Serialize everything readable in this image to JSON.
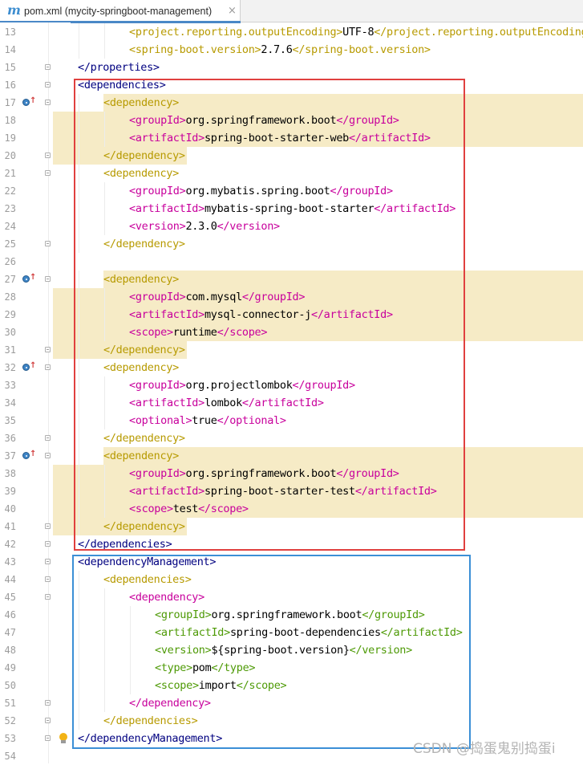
{
  "tab": {
    "icon_letter": "m",
    "title": "pom.xml (mycity-springboot-management)",
    "close_glyph": "×"
  },
  "watermark": "CSDN @捣蛋鬼别捣蛋i",
  "colors": {
    "tag": "#000080",
    "inner_tag": "#c8009c",
    "highlight": "#f6ebc6",
    "red_box": "#e0403f",
    "blue_box": "#3b8fd6"
  },
  "lines": [
    {
      "n": "13",
      "parts": [
        [
          "tag",
          "<project.reporting.outputEncoding>"
        ],
        [
          "txt",
          "UTF-8"
        ],
        [
          "tag",
          "</project.reporting.outputEncoding>"
        ]
      ],
      "indent": 2,
      "style": "hd"
    },
    {
      "n": "14",
      "parts": [
        [
          "tag",
          "<spring-boot.version>"
        ],
        [
          "txt",
          "2.7.6"
        ],
        [
          "tag",
          "</spring-boot.version>"
        ]
      ],
      "indent": 2,
      "style": "hd"
    },
    {
      "n": "15",
      "parts": [
        [
          "tag",
          "</properties>"
        ]
      ],
      "indent": 0,
      "style": "plain",
      "fold": true
    },
    {
      "n": "16",
      "parts": [
        [
          "tag",
          "<dependencies>"
        ]
      ],
      "indent": 0,
      "style": "plain",
      "fold": true
    },
    {
      "n": "17",
      "parts": [
        [
          "tag",
          "<dependency>"
        ]
      ],
      "indent": 1,
      "style": "hd",
      "fold": true,
      "icon": true,
      "hl": "open"
    },
    {
      "n": "18",
      "parts": [
        [
          "tag",
          "<groupId>"
        ],
        [
          "txt",
          "org.springframework.boot"
        ],
        [
          "tag",
          "</groupId>"
        ]
      ],
      "indent": 2,
      "style": "inner",
      "hl": "full"
    },
    {
      "n": "19",
      "parts": [
        [
          "tag",
          "<artifactId>"
        ],
        [
          "txt",
          "spring-boot-starter-web"
        ],
        [
          "tag",
          "</artifactId>"
        ]
      ],
      "indent": 2,
      "style": "inner",
      "hl": "full"
    },
    {
      "n": "20",
      "parts": [
        [
          "tag",
          "</dependency>"
        ]
      ],
      "indent": 1,
      "style": "hd",
      "fold": true,
      "hl": "close"
    },
    {
      "n": "21",
      "parts": [
        [
          "tag",
          "<dependency>"
        ]
      ],
      "indent": 1,
      "style": "hd",
      "fold": true
    },
    {
      "n": "22",
      "parts": [
        [
          "tag",
          "<groupId>"
        ],
        [
          "txt",
          "org.mybatis.spring.boot"
        ],
        [
          "tag",
          "</groupId>"
        ]
      ],
      "indent": 2,
      "style": "inner"
    },
    {
      "n": "23",
      "parts": [
        [
          "tag",
          "<artifactId>"
        ],
        [
          "txt",
          "mybatis-spring-boot-starter"
        ],
        [
          "tag",
          "</artifactId>"
        ]
      ],
      "indent": 2,
      "style": "inner"
    },
    {
      "n": "24",
      "parts": [
        [
          "tag",
          "<version>"
        ],
        [
          "txt",
          "2.3.0"
        ],
        [
          "tag",
          "</version>"
        ]
      ],
      "indent": 2,
      "style": "inner"
    },
    {
      "n": "25",
      "parts": [
        [
          "tag",
          "</dependency>"
        ]
      ],
      "indent": 1,
      "style": "hd",
      "fold": true
    },
    {
      "n": "26",
      "parts": [],
      "indent": 0,
      "style": "plain"
    },
    {
      "n": "27",
      "parts": [
        [
          "tag",
          "<dependency>"
        ]
      ],
      "indent": 1,
      "style": "hd",
      "fold": true,
      "icon": true,
      "hl": "open"
    },
    {
      "n": "28",
      "parts": [
        [
          "tag",
          "<groupId>"
        ],
        [
          "txt",
          "com.mysql"
        ],
        [
          "tag",
          "</groupId>"
        ]
      ],
      "indent": 2,
      "style": "inner",
      "hl": "full"
    },
    {
      "n": "29",
      "parts": [
        [
          "tag",
          "<artifactId>"
        ],
        [
          "txt",
          "mysql-connector-j"
        ],
        [
          "tag",
          "</artifactId>"
        ]
      ],
      "indent": 2,
      "style": "inner",
      "hl": "full"
    },
    {
      "n": "30",
      "parts": [
        [
          "tag",
          "<scope>"
        ],
        [
          "txt",
          "runtime"
        ],
        [
          "tag",
          "</scope>"
        ]
      ],
      "indent": 2,
      "style": "inner",
      "hl": "full"
    },
    {
      "n": "31",
      "parts": [
        [
          "tag",
          "</dependency>"
        ]
      ],
      "indent": 1,
      "style": "hd",
      "fold": true,
      "hl": "close"
    },
    {
      "n": "32",
      "parts": [
        [
          "tag",
          "<dependency>"
        ]
      ],
      "indent": 1,
      "style": "hd",
      "fold": true,
      "icon": true
    },
    {
      "n": "33",
      "parts": [
        [
          "tag",
          "<groupId>"
        ],
        [
          "txt",
          "org.projectlombok"
        ],
        [
          "tag",
          "</groupId>"
        ]
      ],
      "indent": 2,
      "style": "inner"
    },
    {
      "n": "34",
      "parts": [
        [
          "tag",
          "<artifactId>"
        ],
        [
          "txt",
          "lombok"
        ],
        [
          "tag",
          "</artifactId>"
        ]
      ],
      "indent": 2,
      "style": "inner"
    },
    {
      "n": "35",
      "parts": [
        [
          "tag",
          "<optional>"
        ],
        [
          "txt",
          "true"
        ],
        [
          "tag",
          "</optional>"
        ]
      ],
      "indent": 2,
      "style": "inner"
    },
    {
      "n": "36",
      "parts": [
        [
          "tag",
          "</dependency>"
        ]
      ],
      "indent": 1,
      "style": "hd",
      "fold": true
    },
    {
      "n": "37",
      "parts": [
        [
          "tag",
          "<dependency>"
        ]
      ],
      "indent": 1,
      "style": "hd",
      "fold": true,
      "icon": true,
      "hl": "open"
    },
    {
      "n": "38",
      "parts": [
        [
          "tag",
          "<groupId>"
        ],
        [
          "txt",
          "org.springframework.boot"
        ],
        [
          "tag",
          "</groupId>"
        ]
      ],
      "indent": 2,
      "style": "inner",
      "hl": "full"
    },
    {
      "n": "39",
      "parts": [
        [
          "tag",
          "<artifactId>"
        ],
        [
          "txt",
          "spring-boot-starter-test"
        ],
        [
          "tag",
          "</artifactId>"
        ]
      ],
      "indent": 2,
      "style": "inner",
      "hl": "full"
    },
    {
      "n": "40",
      "parts": [
        [
          "tag",
          "<scope>"
        ],
        [
          "txt",
          "test"
        ],
        [
          "tag",
          "</scope>"
        ]
      ],
      "indent": 2,
      "style": "inner",
      "hl": "full"
    },
    {
      "n": "41",
      "parts": [
        [
          "tag",
          "</dependency>"
        ]
      ],
      "indent": 1,
      "style": "hd",
      "fold": true,
      "hl": "close"
    },
    {
      "n": "42",
      "parts": [
        [
          "tag",
          "</dependencies>"
        ]
      ],
      "indent": 0,
      "style": "plain",
      "fold": true
    },
    {
      "n": "43",
      "parts": [
        [
          "tag",
          "<dependencyManagement>"
        ]
      ],
      "indent": 0,
      "style": "plain",
      "fold": true
    },
    {
      "n": "44",
      "parts": [
        [
          "tag",
          "<dependencies>"
        ]
      ],
      "indent": 1,
      "style": "hd",
      "fold": true
    },
    {
      "n": "45",
      "parts": [
        [
          "tag",
          "<dependency>"
        ]
      ],
      "indent": 2,
      "style": "inner",
      "fold": true
    },
    {
      "n": "46",
      "parts": [
        [
          "tag",
          "<groupId>"
        ],
        [
          "txt",
          "org.springframework.boot"
        ],
        [
          "tag",
          "</groupId>"
        ]
      ],
      "indent": 3,
      "style": "green"
    },
    {
      "n": "47",
      "parts": [
        [
          "tag",
          "<artifactId>"
        ],
        [
          "txt",
          "spring-boot-dependencies"
        ],
        [
          "tag",
          "</artifactId>"
        ]
      ],
      "indent": 3,
      "style": "green"
    },
    {
      "n": "48",
      "parts": [
        [
          "tag",
          "<version>"
        ],
        [
          "txt",
          "${spring-boot.version}"
        ],
        [
          "tag",
          "</version>"
        ]
      ],
      "indent": 3,
      "style": "green"
    },
    {
      "n": "49",
      "parts": [
        [
          "tag",
          "<type>"
        ],
        [
          "txt",
          "pom"
        ],
        [
          "tag",
          "</type>"
        ]
      ],
      "indent": 3,
      "style": "green"
    },
    {
      "n": "50",
      "parts": [
        [
          "tag",
          "<scope>"
        ],
        [
          "txt",
          "import"
        ],
        [
          "tag",
          "</scope>"
        ]
      ],
      "indent": 3,
      "style": "green"
    },
    {
      "n": "51",
      "parts": [
        [
          "tag",
          "</dependency>"
        ]
      ],
      "indent": 2,
      "style": "inner",
      "fold": true
    },
    {
      "n": "52",
      "parts": [
        [
          "tag",
          "</dependencies>"
        ]
      ],
      "indent": 1,
      "style": "hd",
      "fold": true
    },
    {
      "n": "53",
      "parts": [
        [
          "tag",
          "</dependencyManagement>"
        ]
      ],
      "indent": 0,
      "style": "plain",
      "fold": true,
      "bulb": true
    },
    {
      "n": "54",
      "parts": [],
      "indent": 0,
      "style": "plain"
    }
  ]
}
